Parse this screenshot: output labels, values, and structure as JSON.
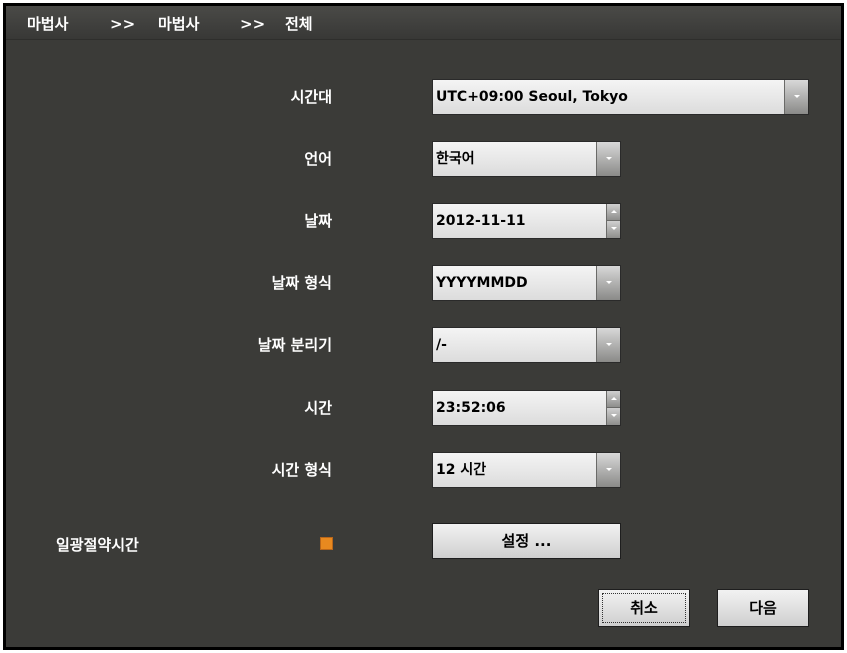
{
  "breadcrumb": {
    "items": [
      "마법사",
      ">>",
      "마법사",
      ">>",
      "전체"
    ]
  },
  "form": {
    "timezone": {
      "label": "시간대",
      "value": "UTC+09:00 Seoul, Tokyo"
    },
    "language": {
      "label": "언어",
      "value": "한국어"
    },
    "date": {
      "label": "날짜",
      "value": "2012-11-11"
    },
    "date_format": {
      "label": "날짜 형식",
      "value": "YYYYMMDD"
    },
    "date_separator": {
      "label": "날짜 분리기",
      "value": "/-"
    },
    "time": {
      "label": "시간",
      "value": "23:52:06"
    },
    "time_format": {
      "label": "시간 형식",
      "value": "12 시간"
    },
    "dst": {
      "label": "일광절약시간",
      "checked": true,
      "settings_label": "설정 ..."
    }
  },
  "footer": {
    "cancel_label": "취소",
    "next_label": "다음"
  },
  "colors": {
    "background": "#3b3b38",
    "checkbox": "#e8891f",
    "field": "#e8e8e8"
  },
  "icons": {
    "dropdown": "chevron-down-icon",
    "spinner": "spinner-arrows-icon"
  }
}
